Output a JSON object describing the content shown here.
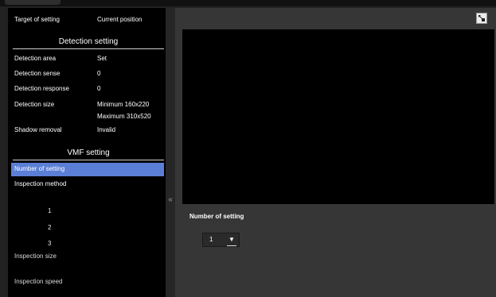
{
  "left_panel": {
    "header": {
      "label": "Target of setting",
      "value": "Current position"
    },
    "detection_section": {
      "title": "Detection setting",
      "rows": [
        {
          "label": "Detection area",
          "value": "Set"
        },
        {
          "label": "Detection sense",
          "value": "0"
        },
        {
          "label": "Detection response",
          "value": "0"
        },
        {
          "label": "Detection size",
          "value": "Minimum 160x220",
          "value2": "Maximum 310x520"
        },
        {
          "label": "Shadow removal",
          "value": "Invalid"
        }
      ]
    },
    "vmf_section": {
      "title": "VMF setting",
      "items": [
        {
          "label": "Number of setting",
          "selected": true
        },
        {
          "label": "Inspection method"
        }
      ],
      "numbers": [
        "1",
        "2",
        "3"
      ],
      "inspection_size": "Inspection size",
      "inspection_speed": "Inspection speed"
    }
  },
  "divider": {
    "icon": "collapse-left-icon",
    "glyph": "«"
  },
  "right_panel": {
    "expand_icon": "expand-icon",
    "setting_label": "Number of setting",
    "setting_select": {
      "value": "1",
      "arrow": "▼"
    }
  },
  "colors": {
    "selected_row": "#5b7fd6",
    "panel_bg": "#000000",
    "right_bg": "#363636"
  }
}
